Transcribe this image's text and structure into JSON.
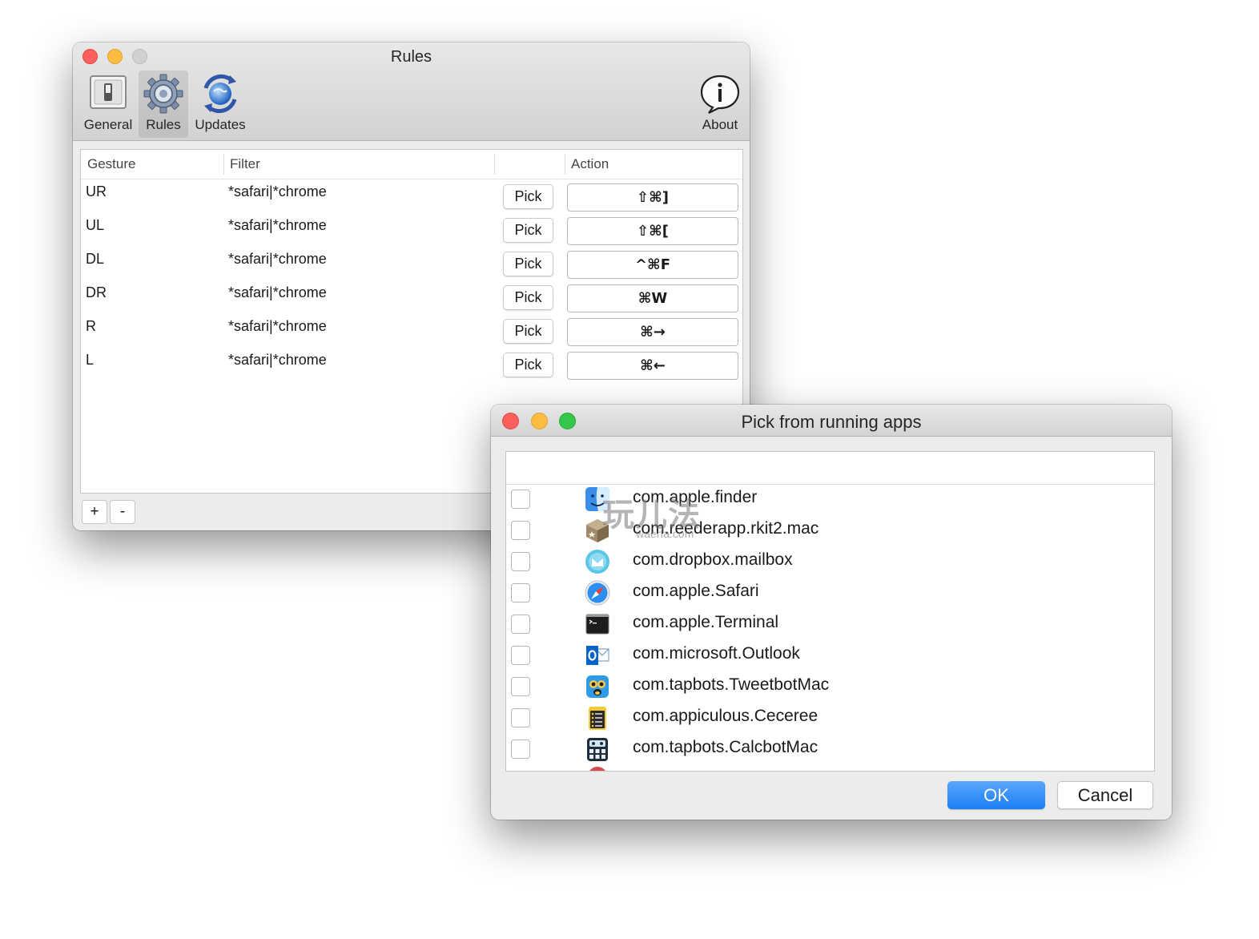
{
  "rules_window": {
    "title": "Rules",
    "toolbar": [
      {
        "label": "General",
        "icon": "switch-icon",
        "selected": false
      },
      {
        "label": "Rules",
        "icon": "gear-icon",
        "selected": true
      },
      {
        "label": "Updates",
        "icon": "updates-globe-icon",
        "selected": false
      },
      {
        "label": "About",
        "icon": "info-bubble-icon",
        "selected": false
      }
    ],
    "columns": [
      "Gesture",
      "Filter",
      "",
      "Action"
    ],
    "rows": [
      {
        "gesture": "UR",
        "filter": "*safari|*chrome",
        "pick": "Pick",
        "action": "⇧⌘]"
      },
      {
        "gesture": "UL",
        "filter": "*safari|*chrome",
        "pick": "Pick",
        "action": "⇧⌘["
      },
      {
        "gesture": "DL",
        "filter": "*safari|*chrome",
        "pick": "Pick",
        "action": "^⌘F"
      },
      {
        "gesture": "DR",
        "filter": "*safari|*chrome",
        "pick": "Pick",
        "action": "⌘W"
      },
      {
        "gesture": "R",
        "filter": "*safari|*chrome",
        "pick": "Pick",
        "action": "⌘→"
      },
      {
        "gesture": "L",
        "filter": "*safari|*chrome",
        "pick": "Pick",
        "action": "⌘←"
      }
    ],
    "add_label": "+",
    "remove_label": "-"
  },
  "pick_window": {
    "title": "Pick from running apps",
    "watermark": {
      "main": "玩儿法",
      "sub": "waerfa.com"
    },
    "apps": [
      {
        "name": "com.apple.finder",
        "icon": "finder-icon",
        "checked": false
      },
      {
        "name": "com.reederapp.rkit2.mac",
        "icon": "reeder-icon",
        "checked": false
      },
      {
        "name": "com.dropbox.mailbox",
        "icon": "mailbox-icon",
        "checked": false
      },
      {
        "name": "com.apple.Safari",
        "icon": "safari-icon",
        "checked": false
      },
      {
        "name": "com.apple.Terminal",
        "icon": "terminal-icon",
        "checked": false
      },
      {
        "name": "com.microsoft.Outlook",
        "icon": "outlook-icon",
        "checked": false
      },
      {
        "name": "com.tapbots.TweetbotMac",
        "icon": "tweetbot-icon",
        "checked": false
      },
      {
        "name": "com.appiculous.Ceceree",
        "icon": "ceceree-icon",
        "checked": false
      },
      {
        "name": "com.tapbots.CalcbotMac",
        "icon": "calcbot-icon",
        "checked": false
      }
    ],
    "ok_label": "OK",
    "cancel_label": "Cancel"
  }
}
